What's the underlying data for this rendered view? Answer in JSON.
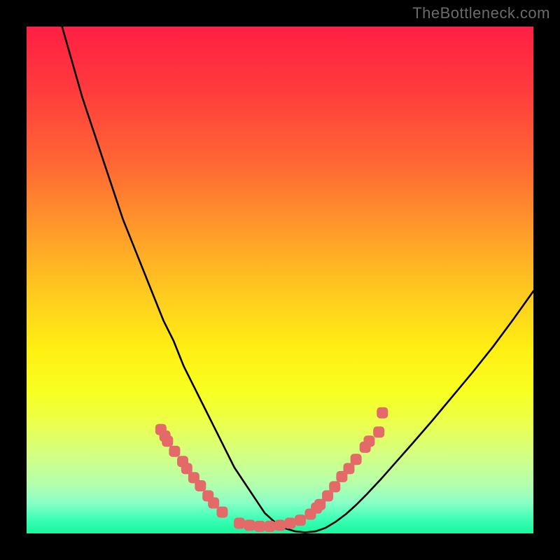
{
  "watermark": {
    "text": "TheBottleneck.com"
  },
  "chart_data": {
    "type": "line",
    "title": "",
    "xlabel": "",
    "ylabel": "",
    "xlim": [
      0,
      100
    ],
    "ylim": [
      0,
      100
    ],
    "grid": false,
    "legend": false,
    "series": [
      {
        "name": "bottleneck-curve",
        "color": "#000000",
        "x": [
          7,
          9,
          11,
          13,
          15,
          17,
          19,
          21,
          23,
          25,
          27,
          29,
          31,
          33,
          35,
          37,
          39,
          41,
          43,
          45,
          47,
          49,
          51,
          53,
          55,
          57,
          59,
          61,
          63,
          65,
          67,
          70,
          73,
          76,
          80,
          84,
          88,
          92,
          96,
          100
        ],
        "values": [
          100,
          93,
          86,
          80,
          74,
          68,
          62,
          57,
          52,
          47,
          42,
          38,
          33,
          29,
          25,
          21,
          17,
          13,
          10,
          7,
          4,
          2.2,
          1,
          0.4,
          0.2,
          0.4,
          1.1,
          2.3,
          3.8,
          5.6,
          7.6,
          10.8,
          14.2,
          17.6,
          22.2,
          27,
          31.8,
          36.8,
          42.2,
          47.8
        ]
      }
    ],
    "markers": [
      {
        "name": "left-cluster-top",
        "shape": "rounded-rect",
        "color": "#e46a6a",
        "points": [
          {
            "x": 26.5,
            "y": 20.5
          },
          {
            "x": 27.3,
            "y": 19.2
          },
          {
            "x": 27.8,
            "y": 18.2
          },
          {
            "x": 29.2,
            "y": 16.2
          },
          {
            "x": 30.8,
            "y": 14.2
          },
          {
            "x": 31.6,
            "y": 12.8
          },
          {
            "x": 33.0,
            "y": 11.0
          },
          {
            "x": 34.3,
            "y": 9.4
          },
          {
            "x": 35.8,
            "y": 7.4
          },
          {
            "x": 36.9,
            "y": 6.0
          },
          {
            "x": 38.6,
            "y": 4.2
          }
        ]
      },
      {
        "name": "right-cluster",
        "shape": "rounded-rect",
        "color": "#e46a6a",
        "points": [
          {
            "x": 56.0,
            "y": 3.8
          },
          {
            "x": 57.2,
            "y": 5.0
          },
          {
            "x": 57.9,
            "y": 5.7
          },
          {
            "x": 59.4,
            "y": 7.4
          },
          {
            "x": 60.8,
            "y": 9.2
          },
          {
            "x": 62.2,
            "y": 11.2
          },
          {
            "x": 63.6,
            "y": 12.8
          },
          {
            "x": 65.0,
            "y": 14.6
          },
          {
            "x": 66.8,
            "y": 17.0
          },
          {
            "x": 67.6,
            "y": 18.2
          },
          {
            "x": 69.5,
            "y": 20.0
          }
        ]
      },
      {
        "name": "bottom-row",
        "shape": "rounded-rect",
        "color": "#e46a6a",
        "points": [
          {
            "x": 42.0,
            "y": 2.0
          },
          {
            "x": 44.0,
            "y": 1.6
          },
          {
            "x": 46.0,
            "y": 1.4
          },
          {
            "x": 48.0,
            "y": 1.4
          },
          {
            "x": 50.0,
            "y": 1.6
          },
          {
            "x": 52.0,
            "y": 2.0
          },
          {
            "x": 54.0,
            "y": 2.6
          }
        ]
      },
      {
        "name": "right-outlier",
        "shape": "rounded-rect",
        "color": "#e46a6a",
        "points": [
          {
            "x": 70.2,
            "y": 23.8
          }
        ]
      }
    ],
    "background_gradient": {
      "direction": "top-to-bottom",
      "stops": [
        {
          "pos": 0,
          "color": "#ff1f43"
        },
        {
          "pos": 28,
          "color": "#ff6a33"
        },
        {
          "pos": 52,
          "color": "#ffc820"
        },
        {
          "pos": 72,
          "color": "#f8ff20"
        },
        {
          "pos": 90,
          "color": "#b6ffaa"
        },
        {
          "pos": 100,
          "color": "#17f79e"
        }
      ]
    }
  }
}
